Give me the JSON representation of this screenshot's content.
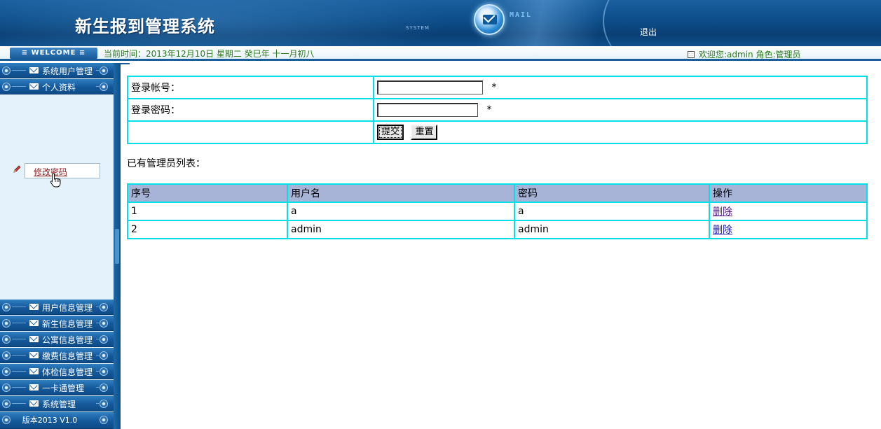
{
  "header": {
    "app_title": "新生报到管理系统",
    "system_text": "SYSTEM",
    "mail_text": "MAIL",
    "logout_label": "退出"
  },
  "statusbar": {
    "welcome_label": "≡ WELCOME ≡",
    "current_time": "当前时间：2013年12月10日 星期二 癸巳年 十一月初八",
    "user_info": "欢迎您:admin 角色:管理员"
  },
  "sidebar": {
    "top_items": [
      {
        "label": "系统用户管理"
      },
      {
        "label": "个人资料"
      }
    ],
    "submenu_item": "修改密码",
    "bottom_items": [
      {
        "label": "用户信息管理"
      },
      {
        "label": "新生信息管理"
      },
      {
        "label": "公寓信息管理"
      },
      {
        "label": "缴费信息管理"
      },
      {
        "label": "体检信息管理"
      },
      {
        "label": "一卡通管理"
      },
      {
        "label": "系统管理"
      }
    ],
    "version_label": "版本2013 V1.0"
  },
  "form": {
    "account_label": "登录帐号：",
    "account_value": "",
    "password_label": "登录密码：",
    "password_value": "",
    "required_mark": "*",
    "submit_label": "提交",
    "reset_label": "重置"
  },
  "admin_list": {
    "heading": "已有管理员列表：",
    "columns": [
      "序号",
      "用户名",
      "密码",
      "操作"
    ],
    "rows": [
      {
        "index": "1",
        "username": "a",
        "password": "a",
        "action": "删除"
      },
      {
        "index": "2",
        "username": "admin",
        "password": "admin",
        "action": "删除"
      }
    ]
  },
  "colors": {
    "header_blue": "#0d4f8c",
    "sidebar_bg": "#e4f3fb",
    "table_border": "#00e0e8",
    "table_head_bg": "#a7b4d8",
    "status_text": "#2a7a1a"
  }
}
